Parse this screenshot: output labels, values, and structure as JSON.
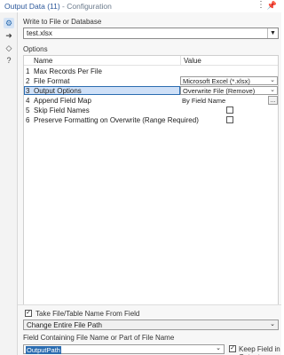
{
  "window": {
    "title": "Output Data (11)",
    "subtitle": " - Configuration",
    "more_icon": "more-vertical-icon",
    "pin_icon": "pin-icon"
  },
  "rail": {
    "items": [
      {
        "name": "gear-icon",
        "glyph": "⚙"
      },
      {
        "name": "arrow-right-icon",
        "glyph": "➜"
      },
      {
        "name": "tag-icon",
        "glyph": "◇"
      },
      {
        "name": "help-icon",
        "glyph": "?"
      }
    ]
  },
  "write_to": {
    "label": "Write to File or Database",
    "value": "test.xlsx"
  },
  "options": {
    "label": "Options",
    "headers": {
      "name": "Name",
      "value": "Value"
    },
    "rows": [
      {
        "num": "1",
        "name": "Max Records Per File",
        "value": "",
        "kind": "none"
      },
      {
        "num": "2",
        "name": "File Format",
        "value": "Microsoft Excel (*.xlsx)",
        "kind": "combo"
      },
      {
        "num": "3",
        "name": "Output Options",
        "value": "Overwrite File (Remove)",
        "kind": "combo"
      },
      {
        "num": "4",
        "name": "Append Field Map",
        "value": "By Field Name",
        "kind": "text-ellipsis"
      },
      {
        "num": "5",
        "name": "Skip Field Names",
        "value": "",
        "kind": "checkbox"
      },
      {
        "num": "6",
        "name": "Preserve Formatting on Overwrite (Range Required)",
        "value": "",
        "kind": "checkbox"
      }
    ],
    "ellipsis": "...",
    "selected_row": 3
  },
  "bottom": {
    "take_file_label": "Take File/Table Name From Field",
    "take_file_checked": true,
    "mode_value": "Change Entire File Path",
    "field_label": "Field Containing File Name or Part of File Name",
    "field_value": "OutputPath",
    "keep_label": "Keep Field in Output",
    "keep_checked": true
  },
  "colors": {
    "accent": "#2b6cb0",
    "selection": "#cfe0f7"
  }
}
